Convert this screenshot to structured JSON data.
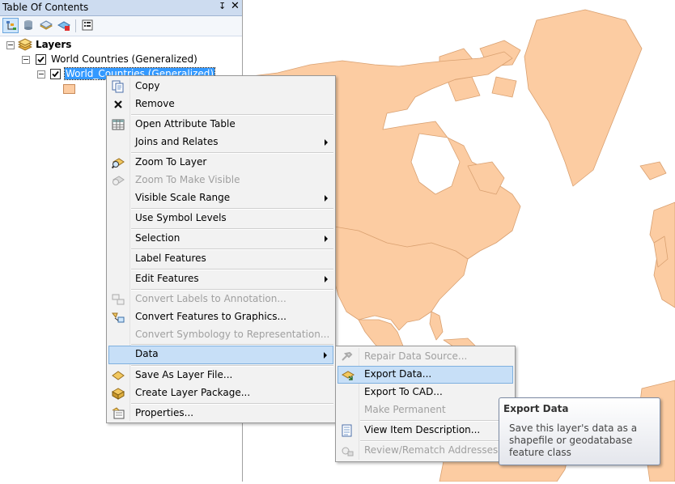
{
  "toc": {
    "title": "Table Of Contents",
    "pin_glyph": "↧",
    "close_glyph": "✕",
    "toolbar": [
      {
        "name": "list-by-drawing-order-icon",
        "active": true
      },
      {
        "name": "list-by-source-icon",
        "active": false
      },
      {
        "name": "list-by-visibility-icon",
        "active": false
      },
      {
        "name": "list-by-selection-icon",
        "active": false
      },
      {
        "name": "options-icon",
        "active": false
      }
    ],
    "tree": {
      "root_label": "Layers",
      "group_label": "World Countries (Generalized)",
      "layer_label": "World_Countries (Generalized)"
    }
  },
  "colors": {
    "land": "#fccca2",
    "land_border": "#d9a070",
    "selection": "#3399ff",
    "menu_highlight": "#c7dff7"
  },
  "context_menu": {
    "items": [
      {
        "label": "Copy",
        "icon": "copy-icon",
        "enabled": true
      },
      {
        "label": "Remove",
        "icon": "remove-icon",
        "enabled": true
      },
      {
        "label": "Open Attribute Table",
        "icon": "attribute-table-icon",
        "enabled": true
      },
      {
        "label": "Joins and Relates",
        "icon": "",
        "enabled": true,
        "submenu": true
      },
      {
        "label": "Zoom To Layer",
        "icon": "zoom-to-layer-icon",
        "enabled": true
      },
      {
        "label": "Zoom To Make Visible",
        "icon": "zoom-to-visible-icon",
        "enabled": false
      },
      {
        "label": "Visible Scale Range",
        "icon": "",
        "enabled": true,
        "submenu": true
      },
      {
        "label": "Use Symbol Levels",
        "icon": "",
        "enabled": true
      },
      {
        "label": "Selection",
        "icon": "",
        "enabled": true,
        "submenu": true
      },
      {
        "label": "Label Features",
        "icon": "",
        "enabled": true
      },
      {
        "label": "Edit Features",
        "icon": "",
        "enabled": true,
        "submenu": true
      },
      {
        "label": "Convert Labels to Annotation...",
        "icon": "convert-labels-icon",
        "enabled": false
      },
      {
        "label": "Convert Features to Graphics...",
        "icon": "convert-features-icon",
        "enabled": true
      },
      {
        "label": "Convert Symbology to Representation...",
        "icon": "",
        "enabled": false
      },
      {
        "label": "Data",
        "icon": "",
        "enabled": true,
        "submenu": true,
        "highlighted": true
      },
      {
        "label": "Save As Layer File...",
        "icon": "save-layer-file-icon",
        "enabled": true
      },
      {
        "label": "Create Layer Package...",
        "icon": "layer-package-icon",
        "enabled": true
      },
      {
        "label": "Properties...",
        "icon": "properties-icon",
        "enabled": true
      }
    ]
  },
  "data_submenu": {
    "items": [
      {
        "label": "Repair Data Source...",
        "icon": "repair-data-source-icon",
        "enabled": false
      },
      {
        "label": "Export Data...",
        "icon": "export-data-icon",
        "enabled": true,
        "highlighted": true
      },
      {
        "label": "Export To CAD...",
        "icon": "",
        "enabled": true
      },
      {
        "label": "Make Permanent",
        "icon": "",
        "enabled": false
      },
      {
        "label": "View Item Description...",
        "icon": "item-description-icon",
        "enabled": true
      },
      {
        "label": "Review/Rematch Addresses...",
        "icon": "rematch-addresses-icon",
        "enabled": false
      }
    ]
  },
  "tooltip": {
    "title": "Export Data",
    "description": "Save this layer's data as a shapefile or geodatabase feature class"
  }
}
